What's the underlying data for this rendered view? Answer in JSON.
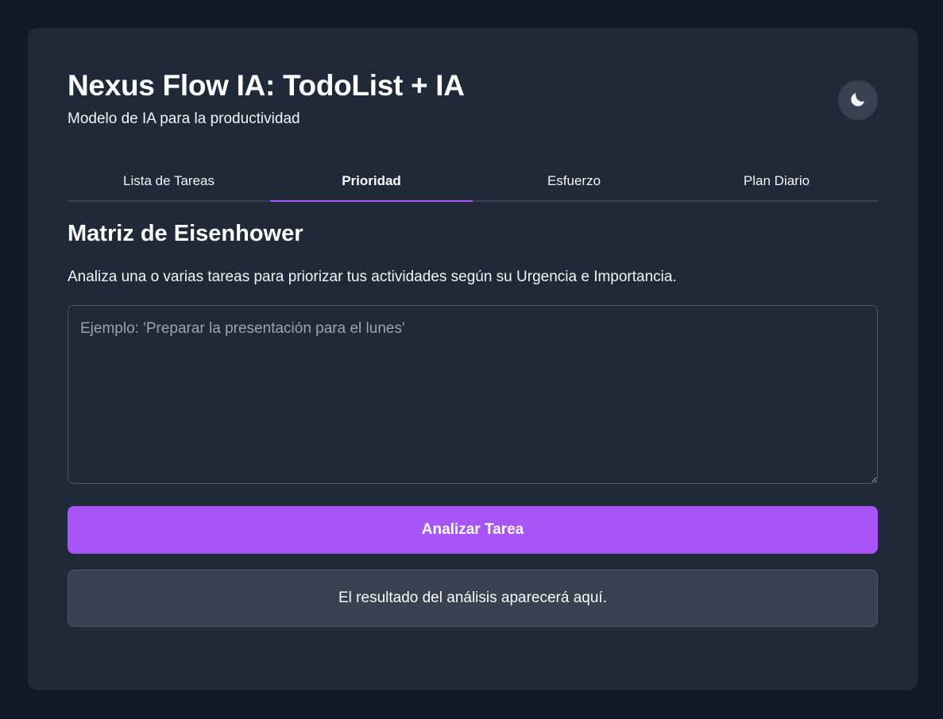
{
  "app": {
    "title": "Nexus Flow IA: TodoList + IA",
    "subtitle": "Modelo de IA para la productividad",
    "theme_toggle_icon": "moon-icon"
  },
  "tabs": [
    {
      "label": "Lista de Tareas",
      "active": false
    },
    {
      "label": "Prioridad",
      "active": true
    },
    {
      "label": "Esfuerzo",
      "active": false
    },
    {
      "label": "Plan Diario",
      "active": false
    }
  ],
  "section": {
    "title": "Matriz de Eisenhower",
    "description": "Analiza una o varias tareas para priorizar tus actividades según su Urgencia e Importancia.",
    "input_placeholder": "Ejemplo: 'Preparar la presentación para el lunes'",
    "input_value": "",
    "button_label": "Analizar Tarea",
    "result_text": "El resultado del análisis aparecerá aquí."
  },
  "colors": {
    "background": "#111827",
    "card": "#1f2937",
    "accent": "#a855f7",
    "result_bg": "#374151"
  }
}
